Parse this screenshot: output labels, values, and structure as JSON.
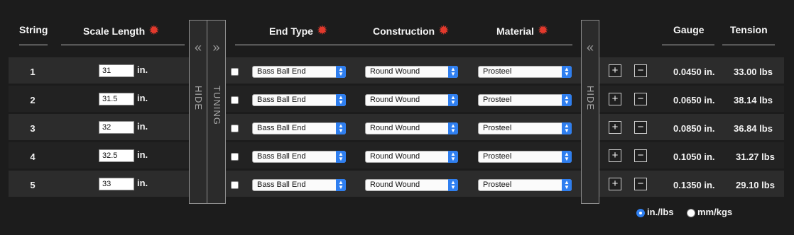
{
  "headers": {
    "string": "String",
    "scale_length": "Scale Length",
    "end_type": "End Type",
    "construction": "Construction",
    "material": "Material",
    "gauge": "Gauge",
    "tension": "Tension",
    "gear_icon": "gear-icon",
    "accent_color": "#e3392c"
  },
  "panels": {
    "hide_left_label": "HIDE",
    "hide_left_arrows": "«",
    "tuning_label": "TUNING",
    "tuning_arrows": "»",
    "hide_right_label": "HIDE",
    "hide_right_arrows": "«"
  },
  "unit_suffix": "in.",
  "rows": [
    {
      "string": "1",
      "scale": "31",
      "end_type": "Bass Ball End",
      "construction": "Round Wound",
      "material": "Prosteel",
      "gauge": "0.0450 in.",
      "tension": "33.00 lbs"
    },
    {
      "string": "2",
      "scale": "31.5",
      "end_type": "Bass Ball End",
      "construction": "Round Wound",
      "material": "Prosteel",
      "gauge": "0.0650 in.",
      "tension": "38.14 lbs"
    },
    {
      "string": "3",
      "scale": "32",
      "end_type": "Bass Ball End",
      "construction": "Round Wound",
      "material": "Prosteel",
      "gauge": "0.0850 in.",
      "tension": "36.84 lbs"
    },
    {
      "string": "4",
      "scale": "32.5",
      "end_type": "Bass Ball End",
      "construction": "Round Wound",
      "material": "Prosteel",
      "gauge": "0.1050 in.",
      "tension": "31.27 lbs"
    },
    {
      "string": "5",
      "scale": "33",
      "end_type": "Bass Ball End",
      "construction": "Round Wound",
      "material": "Prosteel",
      "gauge": "0.1350 in.",
      "tension": "29.10 lbs"
    }
  ],
  "buttons": {
    "plus": "+",
    "minus": "−"
  },
  "units": {
    "options": [
      "in./lbs",
      "mm/kgs"
    ],
    "selected": "in./lbs",
    "accent_color": "#2f7ff0"
  }
}
